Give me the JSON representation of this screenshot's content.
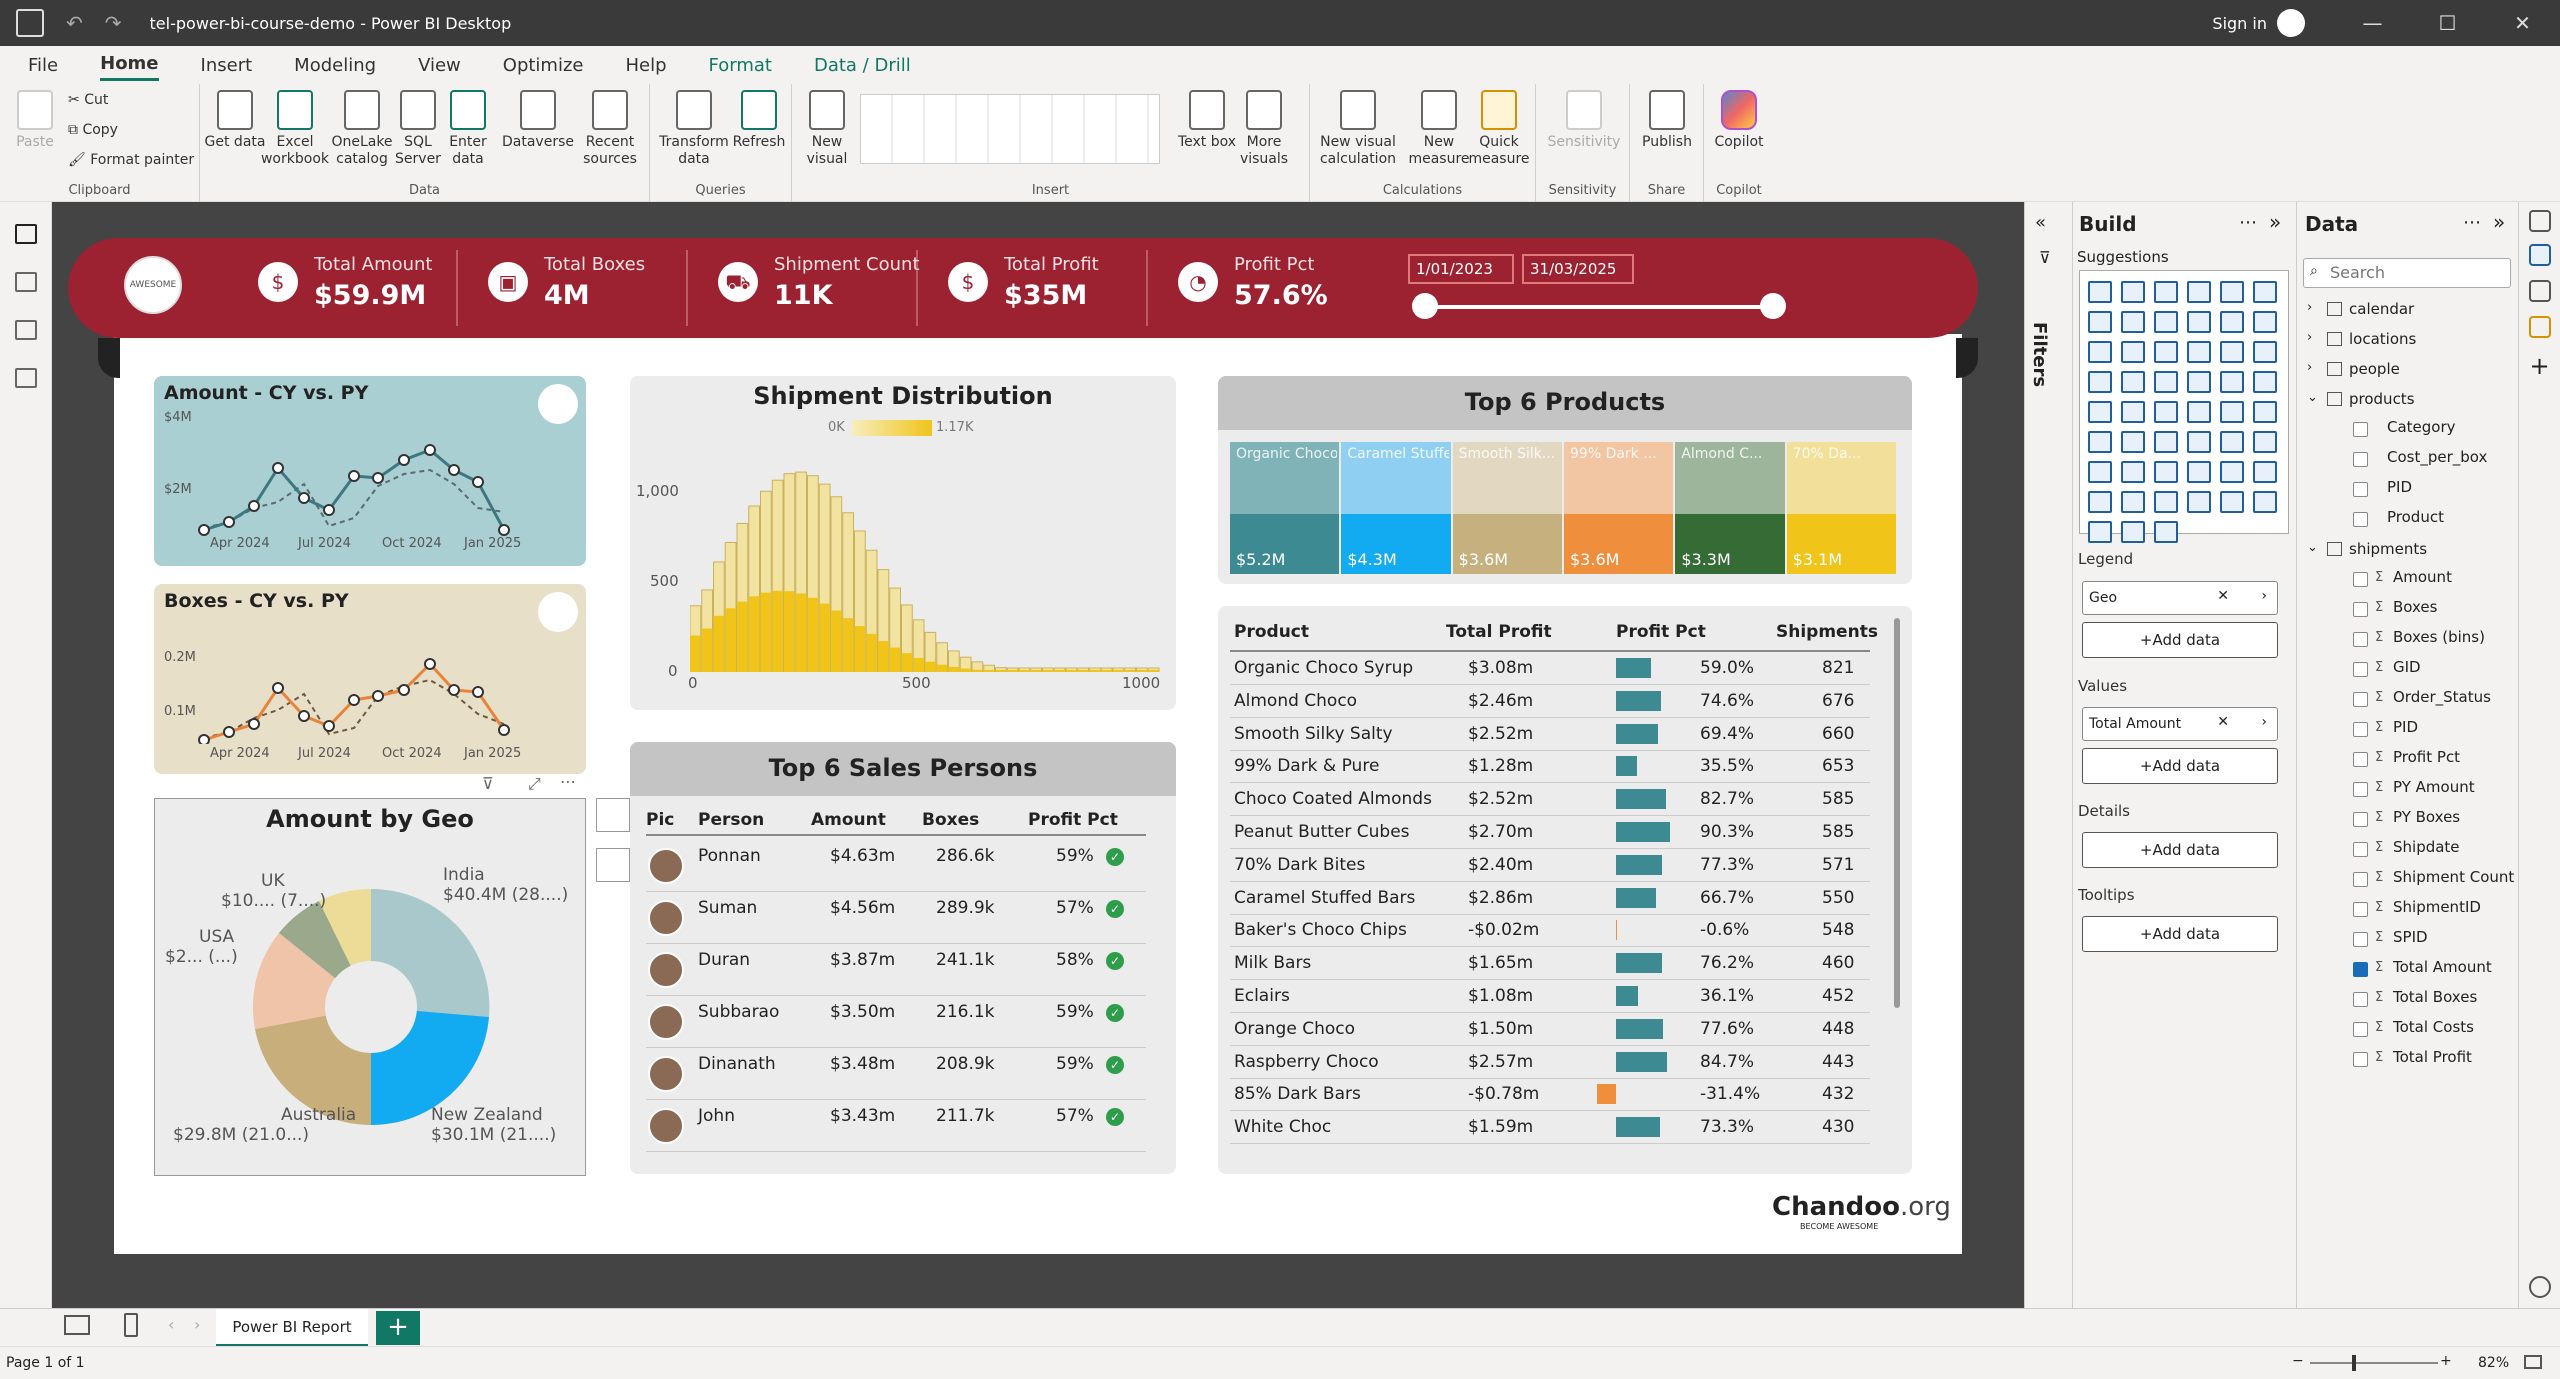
{
  "window": {
    "title": "tel-power-bi-course-demo - Power BI Desktop",
    "sign_in": "Sign in"
  },
  "menu": {
    "tabs": [
      "File",
      "Home",
      "Insert",
      "Modeling",
      "View",
      "Optimize",
      "Help",
      "Format",
      "Data / Drill"
    ]
  },
  "ribbon": {
    "clipboard": {
      "paste": "Paste",
      "cut": "Cut",
      "copy": "Copy",
      "format_painter": "Format painter",
      "label": "Clipboard"
    },
    "data": {
      "get_data": "Get data",
      "excel": "Excel workbook",
      "onelake": "OneLake catalog",
      "sql": "SQL Server",
      "enter": "Enter data",
      "dataverse": "Dataverse",
      "recent": "Recent sources",
      "label": "Data"
    },
    "queries": {
      "transform": "Transform data",
      "refresh": "Refresh",
      "label": "Queries"
    },
    "insert": {
      "new_visual": "New visual",
      "text_box": "Text box",
      "more_visuals": "More visuals",
      "label": "Insert"
    },
    "calculations": {
      "new_visual_calc": "New visual calculation",
      "new_measure": "New measure",
      "quick_measure": "Quick measure",
      "label": "Calculations"
    },
    "sensitivity": {
      "btn": "Sensitivity",
      "label": "Sensitivity"
    },
    "share": {
      "publish": "Publish",
      "label": "Share"
    },
    "copilot": {
      "btn": "Copilot",
      "label": "Copilot"
    }
  },
  "kpis": [
    {
      "label": "Total Amount",
      "value": "$59.9M"
    },
    {
      "label": "Total Boxes",
      "value": "4M"
    },
    {
      "label": "Shipment Count",
      "value": "11K"
    },
    {
      "label": "Total Profit",
      "value": "$35M"
    },
    {
      "label": "Profit Pct",
      "value": "57.6%"
    }
  ],
  "logo_text": "AWESOME",
  "date_range": {
    "start": "1/01/2023",
    "end": "31/03/2025"
  },
  "amount_card": {
    "title": "Amount - CY vs. PY",
    "y_ticks": [
      "$4M",
      "$2M"
    ],
    "x_ticks": [
      "Apr 2024",
      "Jul 2024",
      "Oct 2024",
      "Jan 2025"
    ]
  },
  "boxes_card": {
    "title": "Boxes - CY vs. PY",
    "y_ticks": [
      "0.2M",
      "0.1M"
    ],
    "x_ticks": [
      "Apr 2024",
      "Jul 2024",
      "Oct 2024",
      "Jan 2025"
    ]
  },
  "geo_card": {
    "title": "Amount by Geo",
    "labels": [
      "India",
      "$40.4M (28....)",
      "UK",
      "$10.... (7....)",
      "USA",
      "$2... (...)",
      "Australia",
      "$29.8M (21.0...)",
      "New Zealand",
      "$30.1M (21....)"
    ]
  },
  "shipment_card": {
    "title": "Shipment Distribution",
    "legend_min": "0K",
    "legend_max": "1.17K",
    "y_ticks": [
      "1,000",
      "500",
      "0"
    ],
    "x_ticks": [
      "0",
      "500",
      "1000"
    ]
  },
  "products_card": {
    "title": "Top 6 Products",
    "items": [
      {
        "name": "Organic Choco Sy...",
        "value": "$5.2M",
        "top": "#7fb3b8",
        "bottom": "#3d8a93"
      },
      {
        "name": "Caramel Stuffe...",
        "value": "$4.3M",
        "top": "#8fd0f2",
        "bottom": "#12aaf0"
      },
      {
        "name": "Smooth Silk...",
        "value": "$3.6M",
        "top": "#e2d8c2",
        "bottom": "#c6b07e"
      },
      {
        "name": "99% Dark ...",
        "value": "$3.6M",
        "top": "#f2c6a3",
        "bottom": "#ef8f3d"
      },
      {
        "name": "Almond C...",
        "value": "$3.3M",
        "top": "#9db59b",
        "bottom": "#356b35"
      },
      {
        "name": "70% Da...",
        "value": "$3.1M",
        "top": "#f2e09a",
        "bottom": "#f0c419"
      }
    ]
  },
  "sales_card": {
    "title": "Top 6 Sales Persons",
    "headers": [
      "Pic",
      "Person",
      "Amount",
      "Boxes",
      "Profit Pct"
    ],
    "rows": [
      {
        "person": "Ponnan",
        "amount": "$4.63m",
        "boxes": "286.6k",
        "pct": "59%"
      },
      {
        "person": "Suman",
        "amount": "$4.56m",
        "boxes": "289.9k",
        "pct": "57%"
      },
      {
        "person": "Duran",
        "amount": "$3.87m",
        "boxes": "241.1k",
        "pct": "58%"
      },
      {
        "person": "Subbarao",
        "amount": "$3.50m",
        "boxes": "216.1k",
        "pct": "59%"
      },
      {
        "person": "Dinanath",
        "amount": "$3.48m",
        "boxes": "208.9k",
        "pct": "59%"
      },
      {
        "person": "John",
        "amount": "$3.43m",
        "boxes": "211.7k",
        "pct": "57%"
      }
    ]
  },
  "product_table": {
    "headers": [
      "Product",
      "Total Profit",
      "Profit Pct",
      "Shipments"
    ],
    "rows": [
      {
        "product": "Organic Choco Syrup",
        "profit": "$3.08m",
        "pct": "59.0%",
        "pct_value": 59.0,
        "shipments": "821"
      },
      {
        "product": "Almond Choco",
        "profit": "$2.46m",
        "pct": "74.6%",
        "pct_value": 74.6,
        "shipments": "676"
      },
      {
        "product": "Smooth Silky Salty",
        "profit": "$2.52m",
        "pct": "69.4%",
        "pct_value": 69.4,
        "shipments": "660"
      },
      {
        "product": "99% Dark & Pure",
        "profit": "$1.28m",
        "pct": "35.5%",
        "pct_value": 35.5,
        "shipments": "653"
      },
      {
        "product": "Choco Coated Almonds",
        "profit": "$2.52m",
        "pct": "82.7%",
        "pct_value": 82.7,
        "shipments": "585"
      },
      {
        "product": "Peanut Butter Cubes",
        "profit": "$2.70m",
        "pct": "90.3%",
        "pct_value": 90.3,
        "shipments": "585"
      },
      {
        "product": "70% Dark Bites",
        "profit": "$2.40m",
        "pct": "77.3%",
        "pct_value": 77.3,
        "shipments": "571"
      },
      {
        "product": "Caramel Stuffed Bars",
        "profit": "$2.86m",
        "pct": "66.7%",
        "pct_value": 66.7,
        "shipments": "550"
      },
      {
        "product": "Baker's Choco Chips",
        "profit": "-$0.02m",
        "pct": "-0.6%",
        "pct_value": -0.6,
        "shipments": "548"
      },
      {
        "product": "Milk Bars",
        "profit": "$1.65m",
        "pct": "76.2%",
        "pct_value": 76.2,
        "shipments": "460"
      },
      {
        "product": "Eclairs",
        "profit": "$1.08m",
        "pct": "36.1%",
        "pct_value": 36.1,
        "shipments": "452"
      },
      {
        "product": "Orange Choco",
        "profit": "$1.50m",
        "pct": "77.6%",
        "pct_value": 77.6,
        "shipments": "448"
      },
      {
        "product": "Raspberry Choco",
        "profit": "$2.57m",
        "pct": "84.7%",
        "pct_value": 84.7,
        "shipments": "443"
      },
      {
        "product": "85% Dark Bars",
        "profit": "-$0.78m",
        "pct": "-31.4%",
        "pct_value": -31.4,
        "shipments": "432"
      },
      {
        "product": "White Choc",
        "profit": "$1.59m",
        "pct": "73.3%",
        "pct_value": 73.3,
        "shipments": "430"
      }
    ]
  },
  "chandoo": {
    "brand": "Chandoo",
    "suffix": ".org",
    "tagline": "BECOME AWESOME"
  },
  "filters_label": "Filters",
  "build_pane": {
    "title": "Build",
    "suggestions": "Suggestions",
    "legend": "Legend",
    "legend_value": "Geo",
    "values": "Values",
    "values_value": "Total Amount",
    "details": "Details",
    "tooltips": "Tooltips",
    "add_data": "+Add data"
  },
  "data_pane": {
    "title": "Data",
    "search_placeholder": "Search",
    "tables": [
      "calendar",
      "locations",
      "people",
      "products"
    ],
    "product_fields": [
      "Category",
      "Cost_per_box",
      "PID",
      "Product"
    ],
    "shipments": "shipments",
    "shipment_fields": [
      "Amount",
      "Boxes",
      "Boxes (bins)",
      "GID",
      "Order_Status",
      "PID",
      "Profit Pct",
      "PY Amount",
      "PY Boxes",
      "Shipdate",
      "Shipment Count",
      "ShipmentID",
      "SPID",
      "Total Amount",
      "Total Boxes",
      "Total Costs",
      "Total Profit"
    ]
  },
  "page_tab": "Power BI Report",
  "status": {
    "page": "Page 1 of 1",
    "zoom": "82%"
  },
  "colors": {
    "banner": "#9c2232",
    "teal": "#3d8a93",
    "accent": "#117865"
  }
}
